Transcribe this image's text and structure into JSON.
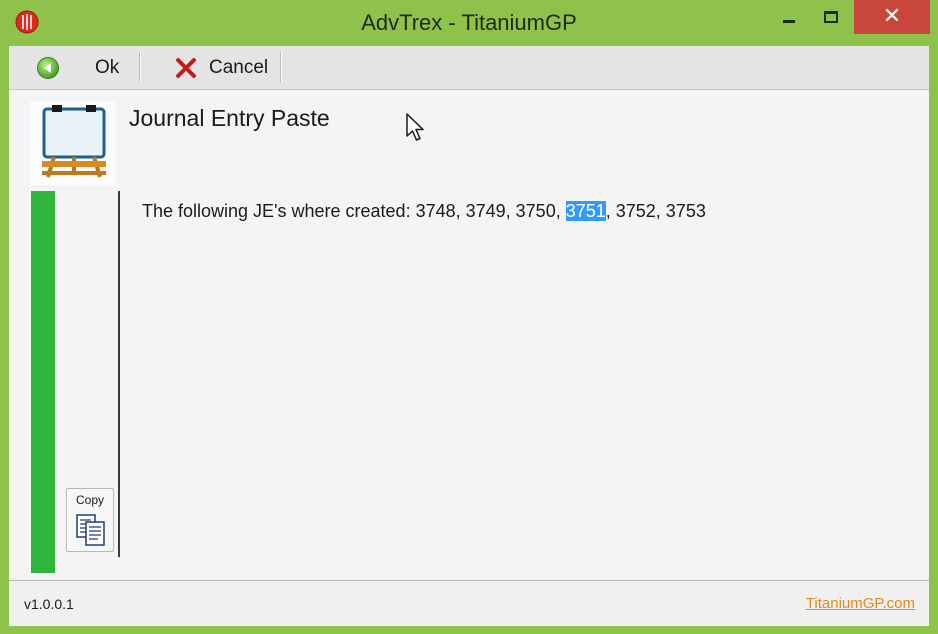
{
  "window": {
    "title": "AdvTrex - TitaniumGP",
    "controls": {
      "minimize_icon": "minimize-icon",
      "maximize_icon": "maximize-icon",
      "close_icon": "close-icon",
      "close_symbol": "✕"
    }
  },
  "toolbar": {
    "ok_label": "Ok",
    "cancel_label": "Cancel"
  },
  "main": {
    "title": "Journal Entry Paste",
    "message_prefix": "The following JE's where created: 3748, 3749, 3750, ",
    "message_selected": "3751",
    "message_suffix": ", 3752, 3753",
    "copy_label": "Copy"
  },
  "footer": {
    "version": "v1.0.0.1",
    "link": "TitaniumGP.com"
  },
  "colors": {
    "frame": "#8fc24a",
    "close_button": "#c9463d",
    "status_bar": "#2fb43c",
    "selection": "#3399ff",
    "link": "#e08a1e"
  }
}
